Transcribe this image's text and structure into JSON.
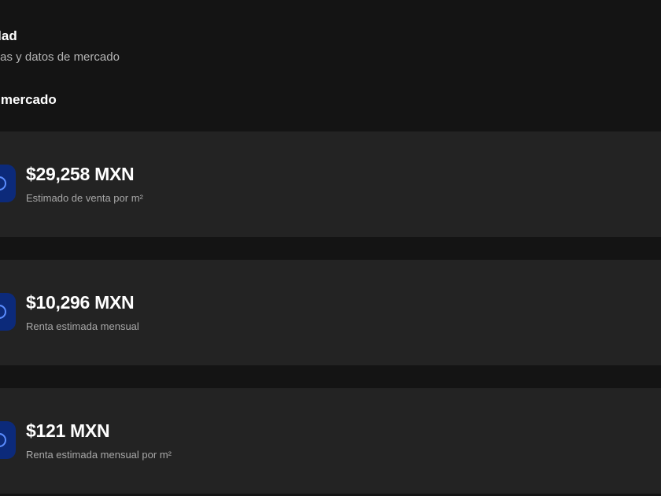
{
  "header": {
    "title": "opiedad",
    "subtitle": "terísticas y datos de mercado"
  },
  "section": {
    "title": "sis de mercado"
  },
  "metrics": [
    {
      "value": "$29,258 MXN",
      "label": "Estimado de venta por m²",
      "icon": "circle-icon"
    },
    {
      "value": "$10,296 MXN",
      "label": "Renta estimada mensual",
      "icon": "circle-icon"
    },
    {
      "value": "$121 MXN",
      "label": "Renta estimada mensual por m²",
      "icon": "circle-icon"
    }
  ],
  "colors": {
    "background": "#141414",
    "card": "#232323",
    "icon_bg": "#0c2a7a",
    "icon_stroke": "#5b8dff",
    "muted_text": "#a8a8a8"
  }
}
